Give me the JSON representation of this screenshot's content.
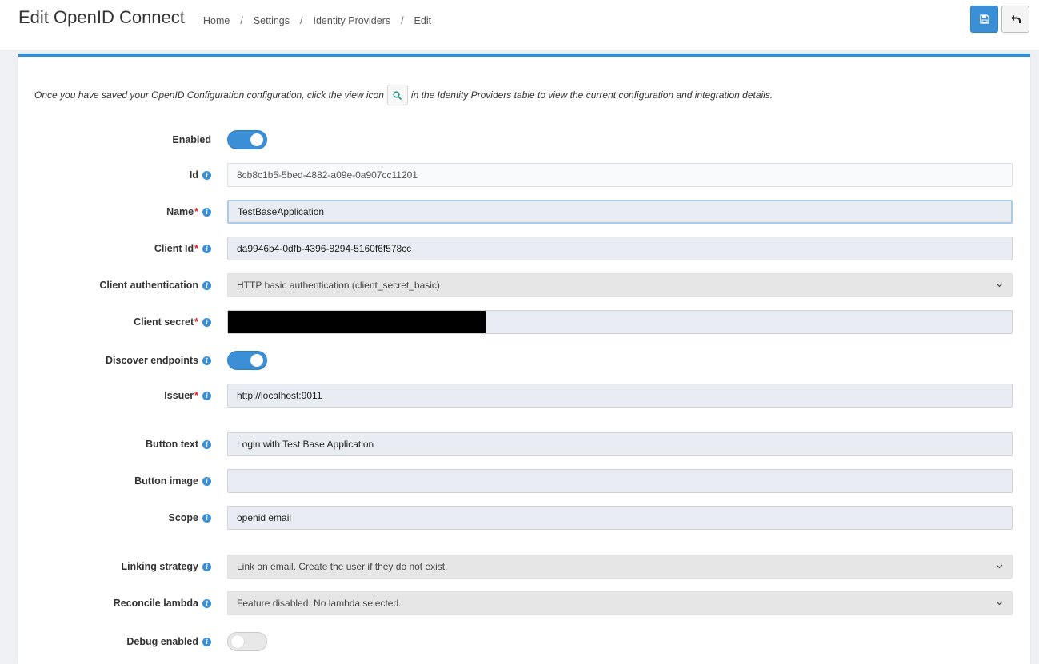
{
  "header": {
    "title": "Edit OpenID Connect",
    "breadcrumb": [
      "Home",
      "Settings",
      "Identity Providers",
      "Edit"
    ],
    "save_icon": "save-icon",
    "back_icon": "undo-arrow-icon"
  },
  "intro": {
    "before": "Once you have saved your OpenID Configuration configuration, click the view icon",
    "after": "in the Identity Providers table to view the current configuration and integration details."
  },
  "form": {
    "enabled": {
      "label": "Enabled",
      "value": true
    },
    "id": {
      "label": "Id",
      "value": "8cb8c1b5-5bed-4882-a09e-0a907cc11201"
    },
    "name": {
      "label": "Name",
      "value": "TestBaseApplication"
    },
    "client_id": {
      "label": "Client Id",
      "value": "da9946b4-0dfb-4396-8294-5160f6f578cc"
    },
    "client_auth": {
      "label": "Client authentication",
      "value": "HTTP basic authentication (client_secret_basic)"
    },
    "client_secret": {
      "label": "Client secret",
      "value": ""
    },
    "discover": {
      "label": "Discover endpoints",
      "value": true
    },
    "issuer": {
      "label": "Issuer",
      "value": "http://localhost:9011"
    },
    "button_text": {
      "label": "Button text",
      "value": "Login with Test Base Application"
    },
    "button_image": {
      "label": "Button image",
      "value": ""
    },
    "scope": {
      "label": "Scope",
      "value": "openid email"
    },
    "linking": {
      "label": "Linking strategy",
      "value": "Link on email. Create the user if they do not exist."
    },
    "reconcile": {
      "label": "Reconcile lambda",
      "value": "Feature disabled. No lambda selected."
    },
    "debug": {
      "label": "Debug enabled",
      "value": false
    }
  },
  "colors": {
    "accent": "#3b8fd6",
    "required": "#dd2222",
    "panel_border": "#2e8fd8"
  }
}
